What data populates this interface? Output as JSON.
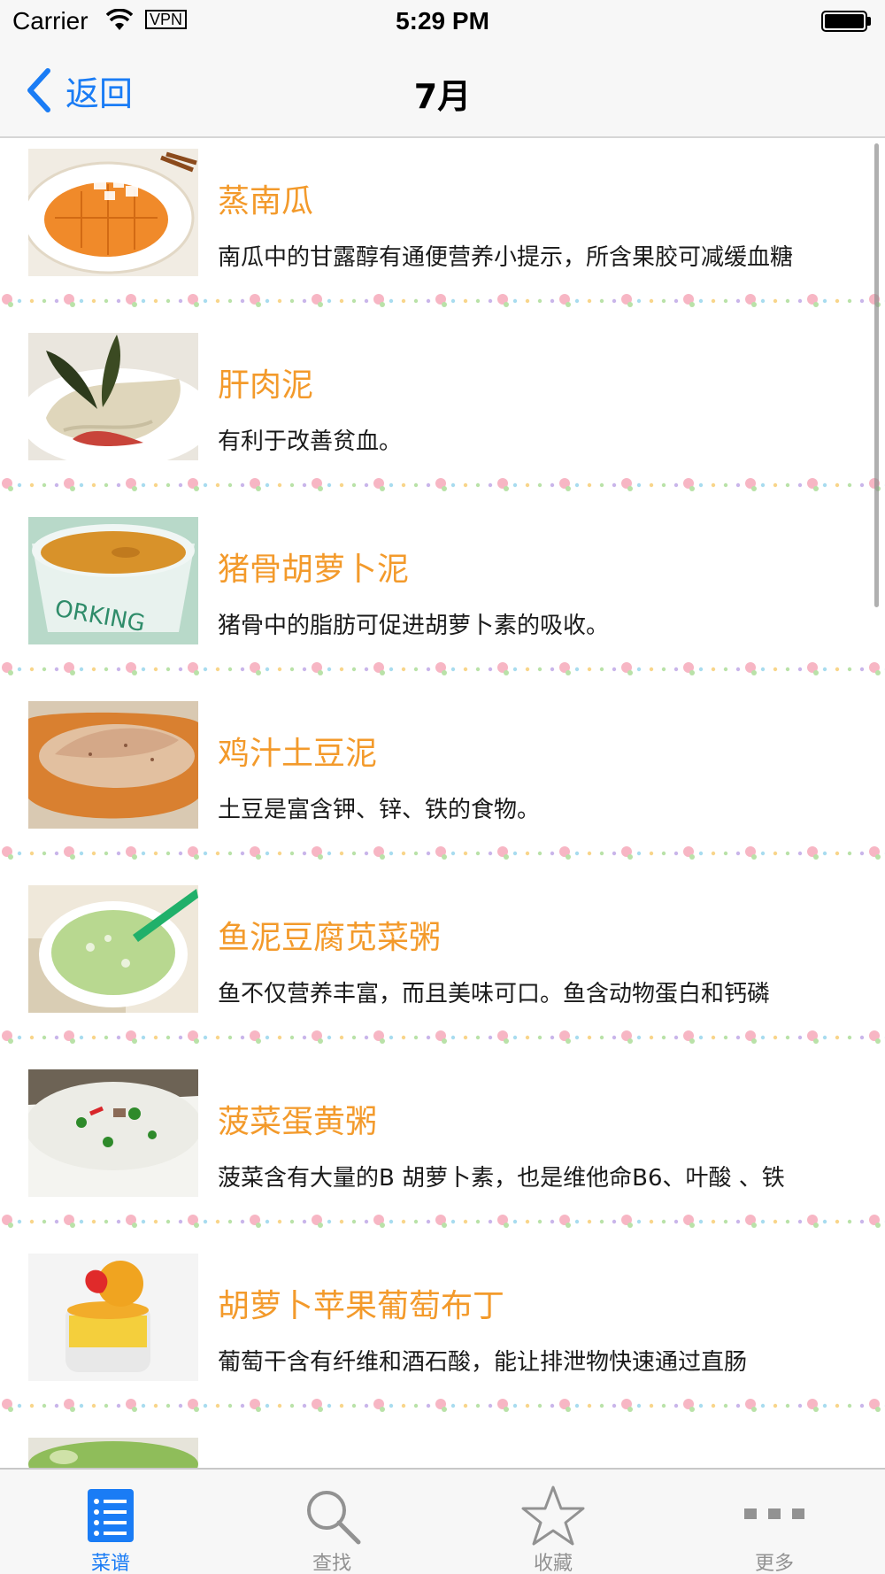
{
  "status_bar": {
    "carrier": "Carrier",
    "vpn": "VPN",
    "time": "5:29 PM"
  },
  "nav": {
    "back_label": "返回",
    "title": "7月"
  },
  "recipes": [
    {
      "title": "蒸南瓜",
      "desc": "南瓜中的甘露醇有通便营养小提示，所含果胶可减缓血糖",
      "thumb": "pumpkin-icon"
    },
    {
      "title": "肝肉泥",
      "desc": "有利于改善贫血。",
      "thumb": "liver-puree-icon"
    },
    {
      "title": "猪骨胡萝卜泥",
      "desc": "猪骨中的脂肪可促进胡萝卜素的吸收。",
      "thumb": "carrot-puree-icon"
    },
    {
      "title": "鸡汁土豆泥",
      "desc": "土豆是富含钾、锌、铁的食物。",
      "thumb": "potato-puree-icon"
    },
    {
      "title": "鱼泥豆腐苋菜粥",
      "desc": "鱼不仅营养丰富，而且美味可口。鱼含动物蛋白和钙磷",
      "thumb": "fish-porridge-icon"
    },
    {
      "title": "菠菜蛋黄粥",
      "desc": "菠菜含有大量的B 胡萝卜素，也是维他命B6、叶酸 、铁",
      "thumb": "spinach-porridge-icon"
    },
    {
      "title": "胡萝卜苹果葡萄布丁",
      "desc": "葡萄干含有纤维和酒石酸，能让排泄物快速通过直肠",
      "thumb": "pudding-icon"
    },
    {
      "title": "",
      "desc": "",
      "thumb": "green-puree-icon"
    }
  ],
  "tabs": [
    {
      "label": "菜谱",
      "icon": "list-icon",
      "active": true
    },
    {
      "label": "查找",
      "icon": "search-icon",
      "active": false
    },
    {
      "label": "收藏",
      "icon": "star-icon",
      "active": false
    },
    {
      "label": "更多",
      "icon": "more-icon",
      "active": false
    }
  ],
  "colors": {
    "accent": "#1a7cf5",
    "title": "#f39a2b",
    "inactive": "#929292"
  }
}
